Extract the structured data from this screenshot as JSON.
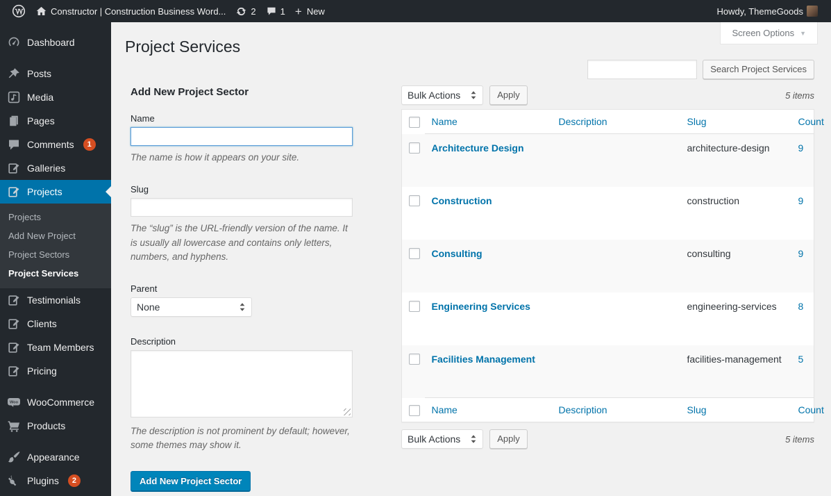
{
  "admin_bar": {
    "site_name": "Constructor | Construction Business Word...",
    "updates_count": "2",
    "comments_count": "1",
    "new_label": "New",
    "howdy_label": "Howdy, ThemeGoods"
  },
  "screen_options": {
    "label": "Screen Options"
  },
  "page": {
    "title": "Project Services"
  },
  "search": {
    "button_label": "Search Project Services"
  },
  "tablenav": {
    "bulk_actions_label": "Bulk Actions",
    "apply_label": "Apply",
    "items_count": "5 items"
  },
  "sidebar": {
    "items": [
      {
        "label": "Dashboard"
      },
      {
        "label": "Posts"
      },
      {
        "label": "Media"
      },
      {
        "label": "Pages"
      },
      {
        "label": "Comments",
        "badge": "1"
      },
      {
        "label": "Galleries"
      },
      {
        "label": "Projects"
      },
      {
        "label": "Testimonials"
      },
      {
        "label": "Clients"
      },
      {
        "label": "Team Members"
      },
      {
        "label": "Pricing"
      },
      {
        "label": "WooCommerce"
      },
      {
        "label": "Products"
      },
      {
        "label": "Appearance"
      },
      {
        "label": "Plugins",
        "badge": "2"
      }
    ],
    "projects_submenu": [
      {
        "label": "Projects"
      },
      {
        "label": "Add New Project"
      },
      {
        "label": "Project Sectors"
      },
      {
        "label": "Project Services"
      }
    ]
  },
  "form": {
    "heading": "Add New Project Sector",
    "name_label": "Name",
    "name_help": "The name is how it appears on your site.",
    "slug_label": "Slug",
    "slug_help": "The “slug” is the URL-friendly version of the name. It is usually all lowercase and contains only letters, numbers, and hyphens.",
    "parent_label": "Parent",
    "parent_value": "None",
    "description_label": "Description",
    "description_help": "The description is not prominent by default; however, some themes may show it.",
    "submit_label": "Add New Project Sector"
  },
  "table": {
    "columns": {
      "name": "Name",
      "description": "Description",
      "slug": "Slug",
      "count": "Count"
    },
    "rows": [
      {
        "name": "Architecture Design",
        "description": "",
        "slug": "architecture-design",
        "count": "9"
      },
      {
        "name": "Construction",
        "description": "",
        "slug": "construction",
        "count": "9"
      },
      {
        "name": "Consulting",
        "description": "",
        "slug": "consulting",
        "count": "9"
      },
      {
        "name": "Engineering Services",
        "description": "",
        "slug": "engineering-services",
        "count": "8"
      },
      {
        "name": "Facilities Management",
        "description": "",
        "slug": "facilities-management",
        "count": "5"
      }
    ]
  },
  "colors": {
    "accent_blue": "#0073aa",
    "primary_button": "#0085ba",
    "badge_red": "#d54e21",
    "admin_dark": "#23282d",
    "content_bg": "#f1f1f1"
  }
}
